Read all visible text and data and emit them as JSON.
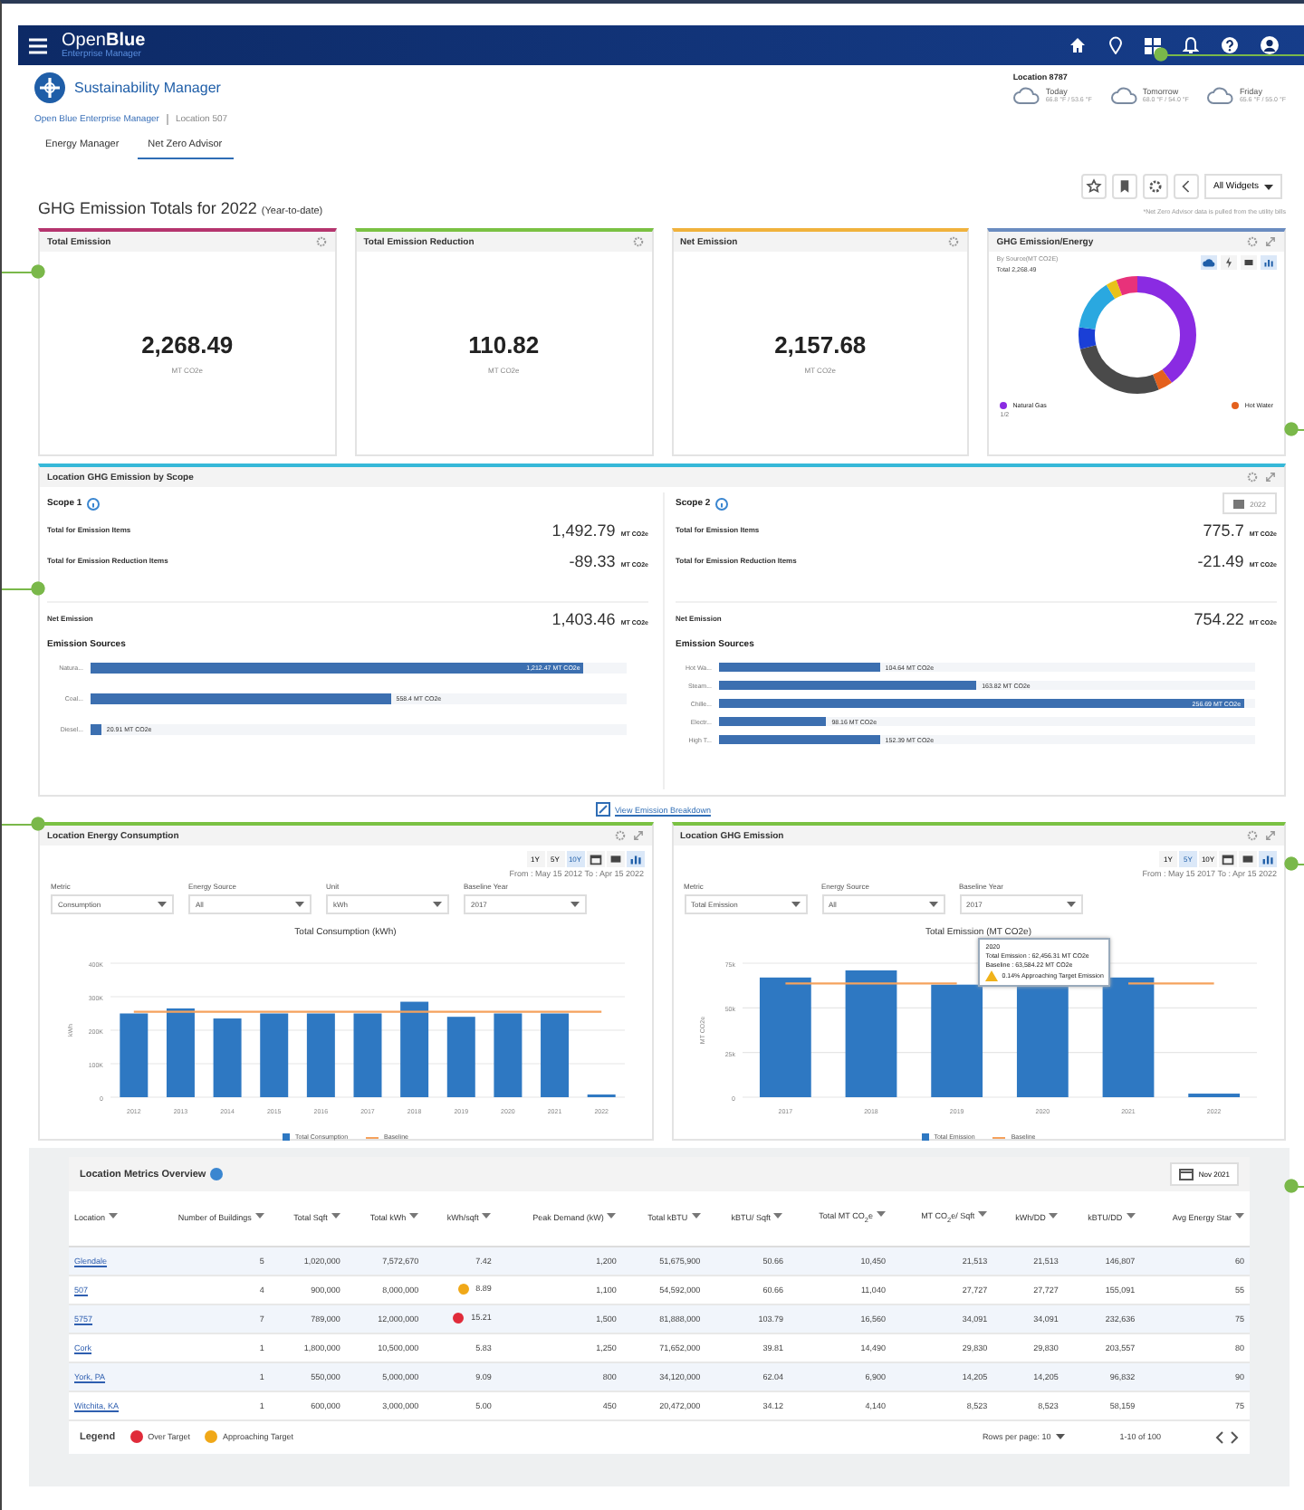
{
  "header": {
    "brand": "Open**Blue**",
    "subtitle": "Enterprise Manager"
  },
  "app": {
    "title": "Sustainability Manager"
  },
  "weather": {
    "location": "Location 8787",
    "days": [
      {
        "day": "Today",
        "temps": "66.8 °F / 53.6 °F"
      },
      {
        "day": "Tomorrow",
        "temps": "68.0 °F / 54.0 °F"
      },
      {
        "day": "Friday",
        "temps": "65.6 °F / 55.0 °F"
      }
    ]
  },
  "breadcrumb": [
    "Open Blue Enterprise Manager",
    "Location 507"
  ],
  "tabs": [
    {
      "label": "Energy Manager",
      "selected": false
    },
    {
      "label": "Net Zero Advisor",
      "selected": true
    }
  ],
  "toolbar": {
    "dropdown": "All Widgets"
  },
  "page_title": "GHG Emission Totals for 2022",
  "page_subtitle": "(Year-to-date)",
  "note": "*Net Zero Advisor data is pulled from the utility bills",
  "kpis": [
    {
      "title": "Total Emission",
      "value": "2,268.49",
      "unit": "MT CO2e",
      "color": "#b5346e"
    },
    {
      "title": "Total Emission Reduction",
      "value": "110.82",
      "unit": "MT CO2e",
      "color": "#7ac143"
    },
    {
      "title": "Net Emission",
      "value": "2,157.68",
      "unit": "MT CO2e",
      "color": "#f0b23c"
    }
  ],
  "energy_mix": {
    "title": "GHG Emission/Energy",
    "subtitle": "By Source(MT CO2E)",
    "total": "Total 2,268.49",
    "legend": [
      {
        "label": "Natural Gas",
        "color": "#8a2be2"
      },
      {
        "label": "Hot Water",
        "color": "#e4601c"
      }
    ],
    "pager": "1/2"
  },
  "scope_panel": {
    "title": "Location GHG Emission by Scope",
    "year": "2022",
    "scopes": [
      {
        "title": "Scope 1",
        "rows": [
          {
            "label": "Total for Emission Items",
            "value": "1,492.79",
            "unit": "MT CO2e"
          },
          {
            "label": "Total for Emission Reduction Items",
            "value": "-89.33",
            "unit": "MT CO2e"
          }
        ],
        "net": {
          "label": "Net Emission",
          "value": "1,403.46",
          "unit": "MT CO2e"
        },
        "sources_title": "Emission Sources",
        "sources": [
          {
            "label": "Natura...",
            "reading": "1,212.47 MT CO2e",
            "level": 0.92
          },
          {
            "label": "Coal...",
            "reading": "558.4 MT CO2e",
            "level": 0.56
          },
          {
            "label": "Diesel...",
            "reading": "20.91 MT CO2e",
            "level": 0.02
          }
        ]
      },
      {
        "title": "Scope 2",
        "rows": [
          {
            "label": "Total for Emission Items",
            "value": "775.7",
            "unit": "MT CO2e"
          },
          {
            "label": "Total for Emission Reduction Items",
            "value": "-21.49",
            "unit": "MT CO2e"
          }
        ],
        "net": {
          "label": "Net Emission",
          "value": "754.22",
          "unit": "MT CO2e"
        },
        "sources_title": "Emission Sources",
        "sources": [
          {
            "label": "Hot Wa...",
            "reading": "104.64 MT CO2e",
            "level": 0.3
          },
          {
            "label": "Steam...",
            "reading": "163.82 MT CO2e",
            "level": 0.48
          },
          {
            "label": "Chille...",
            "reading": "256.69 MT CO2e",
            "level": 0.98
          },
          {
            "label": "Electr...",
            "reading": "98.16 MT CO2e",
            "level": 0.2
          },
          {
            "label": "High T...",
            "reading": "152.39 MT CO2e",
            "level": 0.3
          }
        ]
      }
    ]
  },
  "breakdown_link": "View Emission Breakdown",
  "chart_panels": [
    {
      "title": "Location Energy Consumption",
      "ranges": [
        {
          "label": "1Y",
          "selected": false
        },
        {
          "label": "5Y",
          "selected": false
        },
        {
          "label": "10Y",
          "selected": true
        }
      ],
      "date_range": "From : May 15 2012 To : Apr 15 2022",
      "filters": [
        {
          "label": "Metric",
          "value": "Consumption"
        },
        {
          "label": "Energy Source",
          "value": "All"
        },
        {
          "label": "Unit",
          "value": "kWh"
        },
        {
          "label": "Baseline Year",
          "value": "2017"
        }
      ],
      "chart_data": {
        "type": "bar",
        "title": "Total Consumption (kWh)",
        "ylabel": "kWh",
        "categories": [
          "2012",
          "2013",
          "2014",
          "2015",
          "2016",
          "2017",
          "2018",
          "2019",
          "2020",
          "2021",
          "2022"
        ],
        "series": [
          {
            "name": "Total Consumption",
            "color": "#2e78c2",
            "values": [
              250000,
              265000,
              235000,
              250000,
              250000,
              250000,
              285000,
              240000,
              250000,
              250000,
              8000
            ]
          },
          {
            "name": "Baseline",
            "type": "line",
            "color": "#f5a25d",
            "values": [
              255000,
              255000,
              255000,
              255000,
              255000,
              255000,
              255000,
              255000,
              255000,
              255000,
              255000
            ]
          }
        ],
        "grid": true,
        "ylim": [
          0,
          400000
        ],
        "yticks": [
          {
            "value": 0,
            "label": "0"
          },
          {
            "value": 100000,
            "label": "100K"
          },
          {
            "value": 200000,
            "label": "200K"
          },
          {
            "value": 300000,
            "label": "300K"
          },
          {
            "value": 400000,
            "label": "400K"
          }
        ]
      }
    },
    {
      "title": "Location GHG Emission",
      "ranges": [
        {
          "label": "1Y",
          "selected": false
        },
        {
          "label": "5Y",
          "selected": true
        },
        {
          "label": "10Y",
          "selected": false
        }
      ],
      "date_range": "From : May 15 2017 To : Apr 15 2022",
      "filters": [
        {
          "label": "Metric",
          "value": "Total Emission"
        },
        {
          "label": "Energy Source",
          "value": "All"
        },
        {
          "label": "Baseline Year",
          "value": "2017"
        }
      ],
      "chart_data": {
        "type": "bar",
        "title": "Total Emission (MT CO2e)",
        "ylabel": "MT CO2e",
        "categories": [
          "2017",
          "2018",
          "2019",
          "2020",
          "2021",
          "2022"
        ],
        "series": [
          {
            "name": "Total Emission",
            "color": "#2e78c2",
            "values": [
              67000,
              71000,
              63000,
              62500,
              67000,
              2000
            ]
          },
          {
            "name": "Baseline",
            "type": "line",
            "color": "#f5a25d",
            "values": [
              63600,
              63600,
              63600,
              null,
              63600,
              63600
            ]
          }
        ],
        "grid": true,
        "ylim": [
          0,
          75000
        ],
        "yticks": [
          {
            "value": 0,
            "label": "0"
          },
          {
            "value": 25000,
            "label": "25k"
          },
          {
            "value": 50000,
            "label": "50k"
          },
          {
            "value": 75000,
            "label": "75k"
          }
        ]
      },
      "tooltip": {
        "title": "2020",
        "lines": [
          "Total Emission : 62,456.31 MT CO2e",
          "Baseline : 63,584.22 MT CO2e"
        ],
        "warning": "0.14% Approaching Target Emission"
      }
    }
  ],
  "metrics": {
    "title": "Location Metrics Overview",
    "month": "Nov 2021",
    "columns": [
      "Location",
      "Number of Buildings",
      "Total Sqft",
      "Total kWh",
      "kWh/sqft",
      "Peak Demand (kW)",
      "Total kBTU",
      "kBTU/ Sqft",
      "Total MT CO$_{2}$e",
      "MT CO$_{2}$e/ Sqft",
      "kWh/DD",
      "kBTU/DD",
      "Avg Energy Star"
    ],
    "rows": [
      {
        "over_target": false,
        "approaching_target": false,
        "cells": [
          "Glendale",
          "5",
          "1,020,000",
          "7,572,670",
          "7.42",
          "1,200",
          "51,675,900",
          "50.66",
          "10,450",
          "21,513",
          "21,513",
          "146,807",
          "60"
        ]
      },
      {
        "over_target": false,
        "approaching_target": true,
        "cells": [
          "507",
          "4",
          "900,000",
          "8,000,000",
          "8.89",
          "1,100",
          "54,592,000",
          "60.66",
          "11,040",
          "27,727",
          "27,727",
          "155,091",
          "55"
        ]
      },
      {
        "over_target": true,
        "approaching_target": false,
        "cells": [
          "5757",
          "7",
          "789,000",
          "12,000,000",
          "15.21",
          "1,500",
          "81,888,000",
          "103.79",
          "16,560",
          "34,091",
          "34,091",
          "232,636",
          "75"
        ]
      },
      {
        "over_target": false,
        "approaching_target": false,
        "cells": [
          "Cork",
          "1",
          "1,800,000",
          "10,500,000",
          "5.83",
          "1,250",
          "71,652,000",
          "39.81",
          "14,490",
          "29,830",
          "29,830",
          "203,557",
          "80"
        ]
      },
      {
        "over_target": false,
        "approaching_target": false,
        "cells": [
          "York, PA",
          "1",
          "550,000",
          "5,000,000",
          "9.09",
          "800",
          "34,120,000",
          "62.04",
          "6,900",
          "14,205",
          "14,205",
          "96,832",
          "90"
        ]
      },
      {
        "over_target": false,
        "approaching_target": false,
        "cells": [
          "Witchita, KA",
          "1",
          "600,000",
          "3,000,000",
          "5.00",
          "450",
          "20,472,000",
          "34.12",
          "4,140",
          "8,523",
          "8,523",
          "58,159",
          "75"
        ]
      }
    ],
    "legend_title": "Legend",
    "legend": [
      "Over Target",
      "Approaching Target"
    ],
    "rows_per_page": "Rows per page: 10",
    "range": "1-10 of 100"
  }
}
